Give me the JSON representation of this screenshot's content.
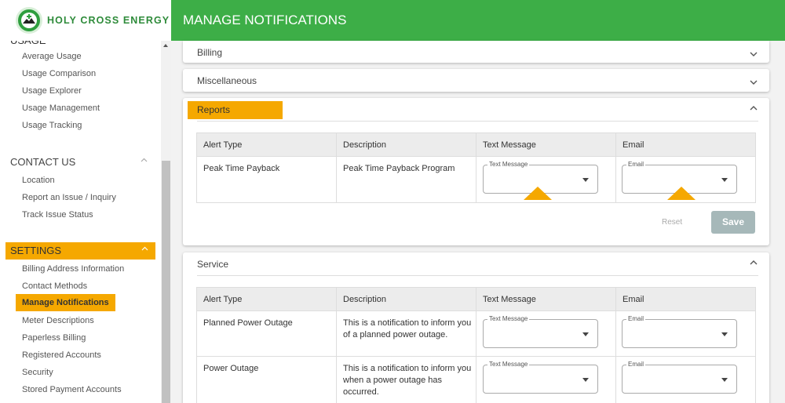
{
  "brand": {
    "name": "HOLY CROSS ENERGY"
  },
  "header": {
    "title": "MANAGE NOTIFICATIONS"
  },
  "sidebar": {
    "cut_section": "USAGE",
    "usage_items": [
      "Average Usage",
      "Usage Comparison",
      "Usage Explorer",
      "Usage Management",
      "Usage Tracking"
    ],
    "contact": {
      "label": "CONTACT US",
      "items": [
        "Location",
        "Report an Issue / Inquiry",
        "Track Issue Status"
      ]
    },
    "settings": {
      "label": "SETTINGS",
      "items": [
        "Billing Address Information",
        "Contact Methods",
        "Manage Notifications",
        "Meter Descriptions",
        "Paperless Billing",
        "Registered Accounts",
        "Security",
        "Stored Payment Accounts"
      ],
      "active_item": "Manage Notifications"
    }
  },
  "panels": {
    "billing": {
      "title": "Billing"
    },
    "misc": {
      "title": "Miscellaneous"
    },
    "reports": {
      "title": "Reports",
      "columns": [
        "Alert Type",
        "Description",
        "Text Message",
        "Email"
      ],
      "rows": [
        {
          "alert_type": "Peak Time Payback",
          "description": "Peak Time Payback Program",
          "text_label": "Text Message",
          "email_label": "Email"
        }
      ],
      "reset_label": "Reset",
      "save_label": "Save"
    },
    "service": {
      "title": "Service",
      "columns": [
        "Alert Type",
        "Description",
        "Text Message",
        "Email"
      ],
      "rows": [
        {
          "alert_type": "Planned Power Outage",
          "description": "This is a notification to inform you of a planned power outage.",
          "text_label": "Text Message",
          "email_label": "Email"
        },
        {
          "alert_type": "Power Outage",
          "description": "This is a notification to inform you when a power outage has occurred.",
          "text_label": "Text Message",
          "email_label": "Email"
        }
      ]
    }
  },
  "icons": {
    "expand": "chevron-down-icon",
    "collapse": "chevron-up-icon",
    "dropdown": "caret-down-icon",
    "logo": "holy-cross-logo-icon"
  },
  "colors": {
    "brand_green": "#3dae47",
    "highlight": "#f5a800",
    "save_button": "#a6b8b9"
  }
}
